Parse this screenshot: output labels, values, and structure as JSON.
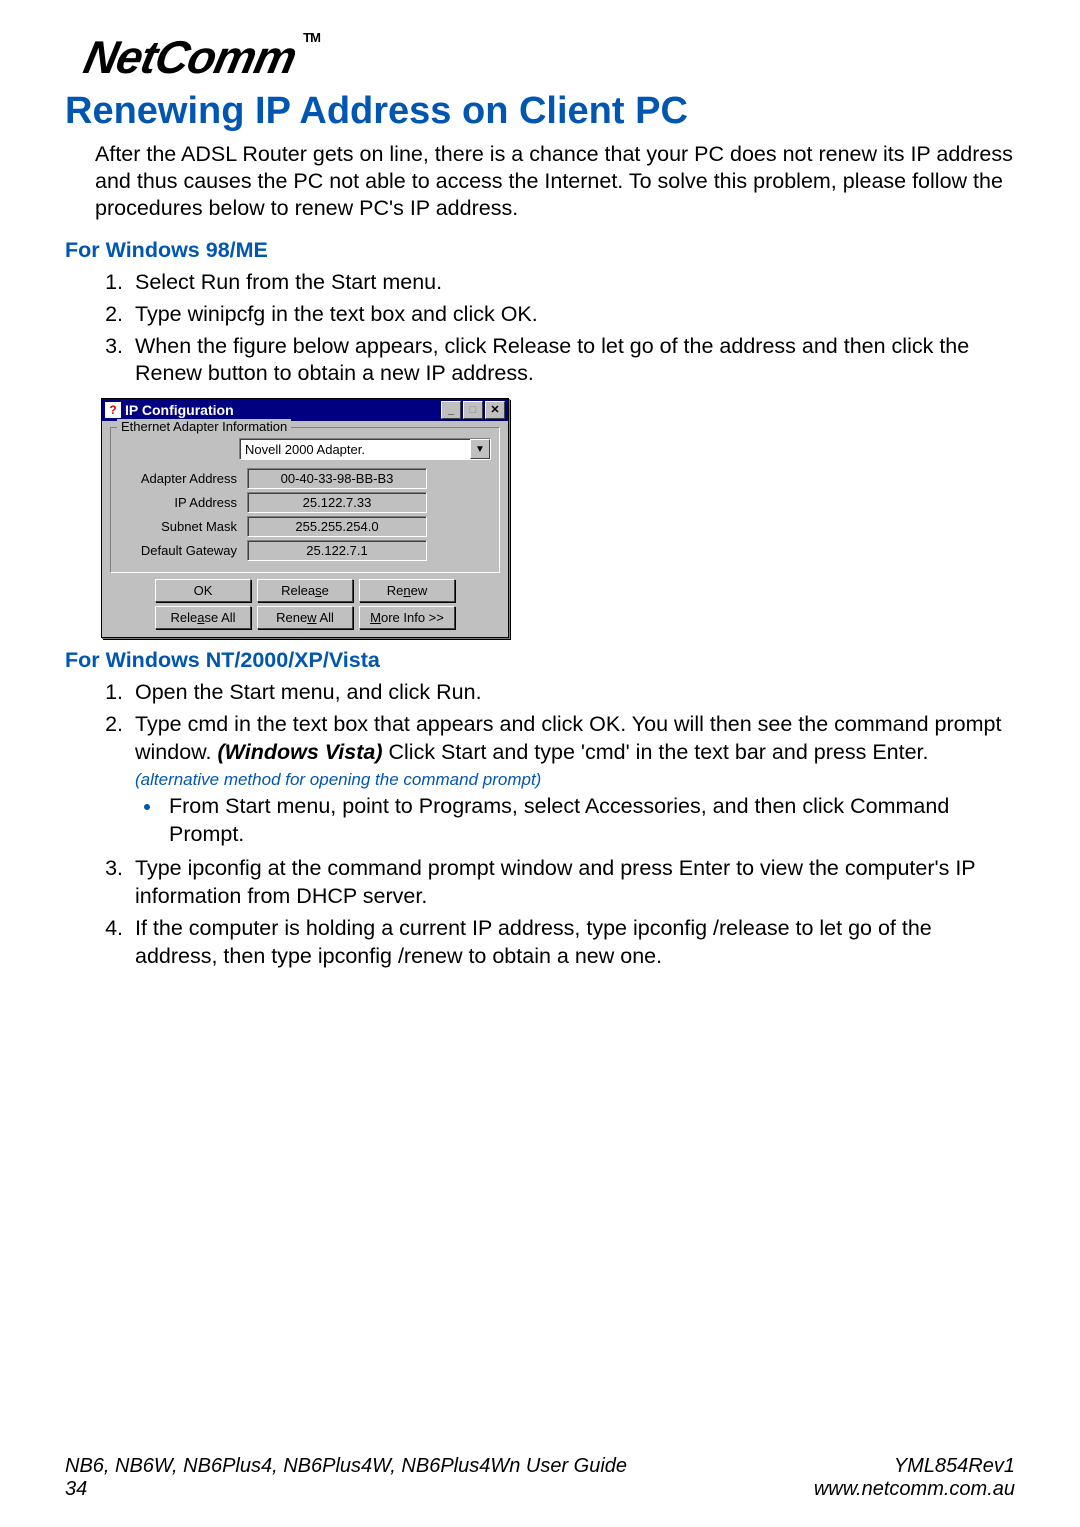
{
  "brand": {
    "name": "NetComm",
    "tm": "TM"
  },
  "heading": "Renewing IP Address on Client PC",
  "intro": "After the ADSL Router gets on line, there is a chance that your PC does not renew its IP address and thus causes the PC not able to access the Internet. To solve this problem, please follow the procedures below to renew PC's IP address.",
  "win98": {
    "heading": "For Windows 98/ME",
    "step1": "Select Run from the Start menu.",
    "step2": "Type winipcfg in the text box and click OK.",
    "step3": "When the figure below appears, click Release to let go of the address and then click the Renew button to obtain a new IP address."
  },
  "ipcfg": {
    "title": "IP Configuration",
    "group_label": "Ethernet Adapter Information",
    "adapter_select": "Novell 2000 Adapter.",
    "rows": {
      "adapter_address": {
        "label": "Adapter Address",
        "value": "00-40-33-98-BB-B3"
      },
      "ip_address": {
        "label": "IP Address",
        "value": "25.122.7.33"
      },
      "subnet_mask": {
        "label": "Subnet Mask",
        "value": "255.255.254.0"
      },
      "default_gateway": {
        "label": "Default Gateway",
        "value": "25.122.7.1"
      }
    },
    "buttons": {
      "ok": "OK",
      "release": "Release",
      "renew": "Renew",
      "release_all": "Release All",
      "renew_all": "Renew All",
      "more_info": "More Info >>"
    }
  },
  "winnt": {
    "heading": "For Windows NT/2000/XP/Vista",
    "step1": "Open the Start menu, and click Run.",
    "step2_a": "Type cmd in the text box that appears and click OK. You will then see the command prompt window. ",
    "step2_vista_label": "(Windows Vista)",
    "step2_vista_text": " Click Start and type 'cmd' in the text bar and press Enter.",
    "step2_alt": "(alternative method for opening the command prompt)",
    "step2_bullet": "From Start menu, point to Programs, select Accessories, and then click Command Prompt.",
    "step3": "Type ipconfig at the command prompt window and press Enter to view the computer's IP information from DHCP server.",
    "step4": "If the computer is holding a current IP address, type ipconfig /release to let go of the address, then type ipconfig /renew to obtain a new one."
  },
  "footer": {
    "guide": "NB6, NB6W, NB6Plus4, NB6Plus4W, NB6Plus4Wn User Guide",
    "page": "34",
    "rev": "YML854Rev1",
    "url": "www.netcomm.com.au"
  }
}
